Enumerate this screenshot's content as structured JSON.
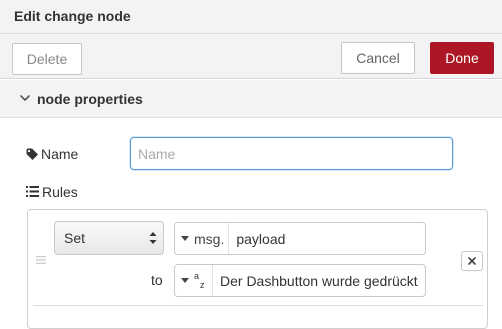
{
  "dialog": {
    "title": "Edit change node"
  },
  "toolbar": {
    "delete_label": "Delete",
    "cancel_label": "Cancel",
    "done_label": "Done"
  },
  "section": {
    "title": "node properties",
    "expanded": true
  },
  "form": {
    "name": {
      "label": "Name",
      "value": "",
      "placeholder": "Name"
    },
    "rules": {
      "label": "Rules",
      "items": [
        {
          "action": "Set",
          "target_type": "msg.",
          "target_value": "payload",
          "to_label": "to",
          "value_type": "az",
          "value": "Der Dashbutton wurde gedrückt"
        }
      ]
    }
  },
  "colors": {
    "done_button": "#ad1625",
    "focus_border": "#5b9bd5",
    "panel_bg": "#f3f3f3"
  },
  "icons": [
    "chevron-down-icon",
    "tag-icon",
    "list-icon",
    "drag-handle-icon",
    "caret-down-icon",
    "string-type-icon",
    "close-icon",
    "up-down-arrows-icon"
  ]
}
